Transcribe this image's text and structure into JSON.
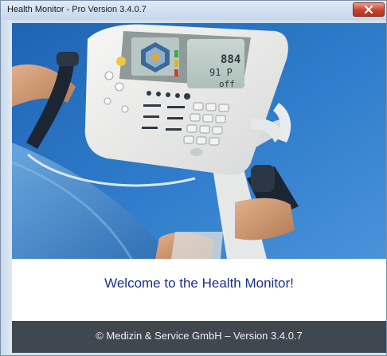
{
  "window": {
    "title": "Health Monitor - Pro Version 3.4.0.7",
    "close_icon": "close-icon"
  },
  "device_display": {
    "readout_1": "884",
    "readout_2": "91 P",
    "readout_3": "off"
  },
  "welcome": {
    "message": "Welcome to the Health Monitor!"
  },
  "footer": {
    "copyright": "© Medizin & Service GmbH – Version 3.4.0.7"
  },
  "colors": {
    "welcome_text": "#1e2f88",
    "footer_bg": "#3f474f",
    "close_button": "#c8432b"
  }
}
